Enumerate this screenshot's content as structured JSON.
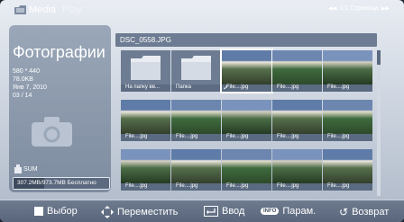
{
  "header": {
    "app_name": "Media",
    "app_sub": "Play",
    "page": "1/1 Страница"
  },
  "left_panel": {
    "title": "Фотографии",
    "resolution": "580 * 440",
    "size": "78.0KB",
    "date": "Янв 7, 2010",
    "index": "03 / 14",
    "storage_name": "SUM",
    "storage_text": "307.2MB/973.7MB Бесплатно",
    "storage_free_fraction": 0.32
  },
  "file_bar": {
    "name": "DSC_0558.JPG"
  },
  "grid": {
    "items": [
      {
        "label": "На папку вв...",
        "type": "folder"
      },
      {
        "label": "Папка",
        "type": "folder"
      },
      {
        "label": "File....jpg",
        "type": "photo",
        "selected": true
      },
      {
        "label": "File....jpg",
        "type": "photo"
      },
      {
        "label": "File....jpg",
        "type": "photo"
      },
      {
        "label": "File....jpg",
        "type": "photo"
      },
      {
        "label": "File....jpg",
        "type": "photo"
      },
      {
        "label": "File....jpg",
        "type": "photo"
      },
      {
        "label": "File....jpg",
        "type": "photo"
      },
      {
        "label": "File....jpg",
        "type": "photo"
      },
      {
        "label": "File....jpg",
        "type": "photo"
      },
      {
        "label": "File....jpg",
        "type": "photo"
      },
      {
        "label": "File....jpg",
        "type": "photo"
      },
      {
        "label": "File....jpg",
        "type": "photo"
      },
      {
        "label": "File....jpg",
        "type": "photo"
      }
    ]
  },
  "footer": {
    "select": "Выбор",
    "move": "Переместить",
    "enter": "Ввод",
    "info_badge": "INFO",
    "params": "Парам.",
    "back": "Возврат"
  },
  "icons": {
    "logo": "media-play-logo-icon",
    "camera": "camera-icon",
    "storage": "usb-storage-icon",
    "move": "four-way-arrow-icon",
    "enter": "enter-icon",
    "back": "return-icon"
  },
  "colors": {
    "accent": "#5b6a80",
    "selection": "#ffffff"
  }
}
